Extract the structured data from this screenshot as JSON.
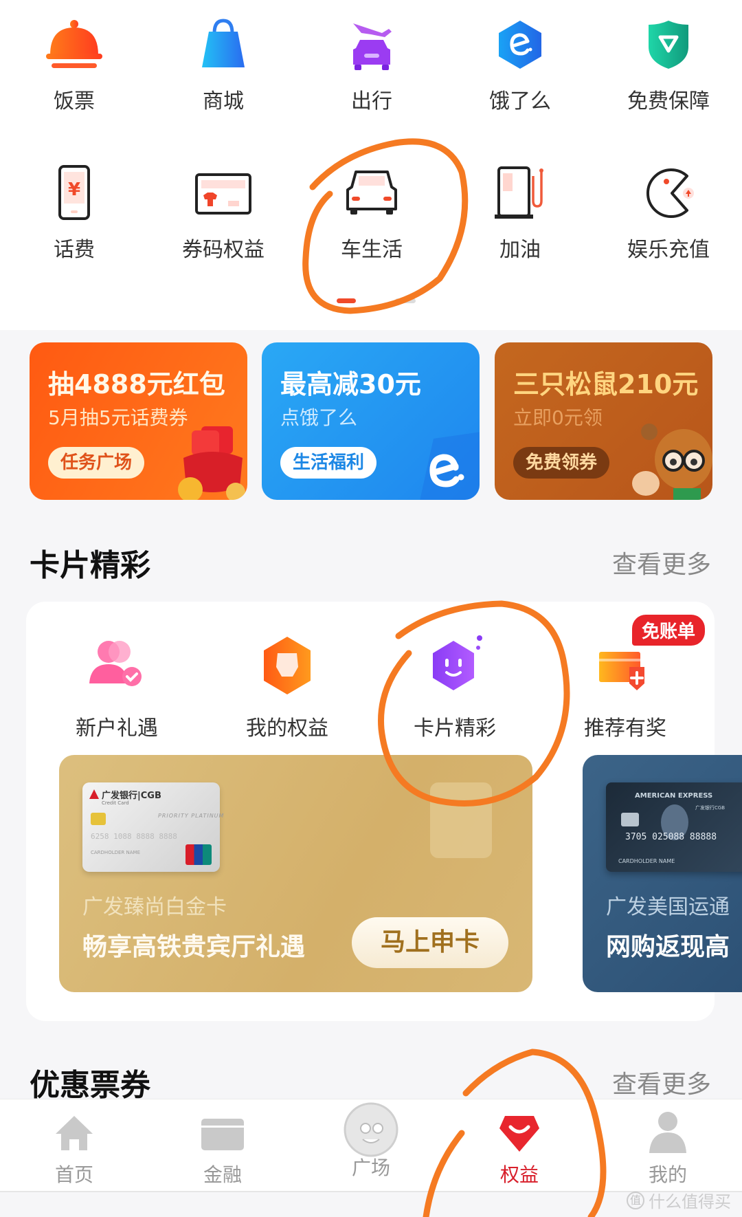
{
  "quick_grid": {
    "row1": [
      {
        "label": "饭票",
        "icon": "dish-cover-icon"
      },
      {
        "label": "商城",
        "icon": "shopping-bag-icon"
      },
      {
        "label": "出行",
        "icon": "plane-car-icon"
      },
      {
        "label": "饿了么",
        "icon": "eleme-icon"
      },
      {
        "label": "免费保障",
        "icon": "shield-icon"
      }
    ],
    "row2": [
      {
        "label": "话费",
        "icon": "phone-yuan-icon"
      },
      {
        "label": "券码权益",
        "icon": "coupon-card-icon"
      },
      {
        "label": "车生活",
        "icon": "car-icon"
      },
      {
        "label": "加油",
        "icon": "fuel-pump-icon"
      },
      {
        "label": "娱乐充值",
        "icon": "pacman-icon"
      }
    ],
    "pager": {
      "active_page": 1,
      "total_pages": 2
    }
  },
  "banners": [
    {
      "title": "抽4888元红包",
      "subtitle": "5月抽5元话费券",
      "button": "任务广场",
      "bg": "#fa5a14",
      "accent": "#fff3d6"
    },
    {
      "title": "最高减30元",
      "subtitle": "点饿了么",
      "button": "生活福利",
      "bg": "#1e9bf0",
      "accent": "#ffffff"
    },
    {
      "title": "三只松鼠210元",
      "subtitle": "立即0元领",
      "button": "免费领券",
      "bg": "#c2661f",
      "accent": "#ffd98a"
    }
  ],
  "card_section": {
    "title": "卡片精彩",
    "more": "查看更多",
    "entries": [
      {
        "label": "新户礼遇",
        "icon": "new-user-icon"
      },
      {
        "label": "我的权益",
        "icon": "my-benefits-icon"
      },
      {
        "label": "卡片精彩",
        "icon": "smiley-hexagon-icon"
      },
      {
        "label": "推荐有奖",
        "icon": "referral-card-icon",
        "badge": "免账单"
      }
    ],
    "cards": [
      {
        "bank": "广发银行|CGB",
        "card_type": "Credit Card",
        "tier": "PRIORITY PLATINUM",
        "card_number": "6258 1088 8888 8888",
        "holder": "CARDHOLDER NAME",
        "network": "UnionPay 银联",
        "name": "广发臻尚白金卡",
        "slogan": "畅享高铁贵宾厅礼遇",
        "cta": "马上申卡"
      },
      {
        "brand": "AMERICAN EXPRESS",
        "bank": "广发银行CGB",
        "card_number": "3705 025088 88888",
        "holder": "CARDHOLDER NAME",
        "name": "广发美国运通",
        "slogan": "网购返现高"
      }
    ]
  },
  "coupon_section": {
    "title": "优惠票券",
    "more": "查看更多"
  },
  "tabbar": {
    "tabs": [
      {
        "label": "首页",
        "icon": "home-icon",
        "active": false
      },
      {
        "label": "金融",
        "icon": "card-icon",
        "active": false
      },
      {
        "label": "广场",
        "icon": "mascot-avatar-icon",
        "active": false
      },
      {
        "label": "权益",
        "icon": "gem-smile-icon",
        "active": true
      },
      {
        "label": "我的",
        "icon": "person-icon",
        "active": false
      }
    ]
  },
  "watermark": {
    "logo": "值",
    "text": "什么值得买"
  },
  "colors": {
    "brand_red": "#d81e2a",
    "annotation_orange": "#f57a22",
    "section_title": "#111111",
    "muted_text": "#888888"
  }
}
